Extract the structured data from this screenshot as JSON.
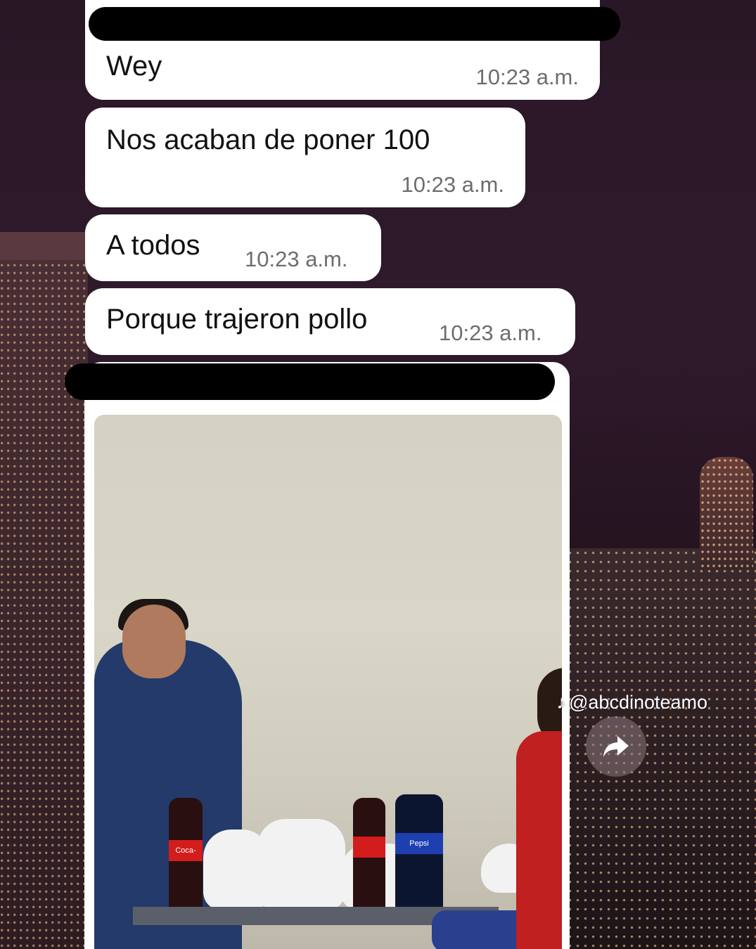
{
  "messages": [
    {
      "text": "Wey",
      "time": "10:23 a.m."
    },
    {
      "text": "Nos acaban de poner 100",
      "time": "10:23 a.m."
    },
    {
      "text": "A todos",
      "time": "10:23 a.m."
    },
    {
      "text": "Porque trajeron pollo",
      "time": "10:23 a.m."
    }
  ],
  "photo": {
    "bottle_labels": [
      "Coca-Cola",
      "Pepsi"
    ]
  },
  "overlay": {
    "watermark_handle": "@abcdinoteamo",
    "tiktok_icon": "tiktok-logo-icon",
    "share_icon": "share-arrow-icon"
  },
  "colors": {
    "bubble": "#ffffff",
    "time": "#6d6d6d",
    "redaction": "#000000"
  }
}
